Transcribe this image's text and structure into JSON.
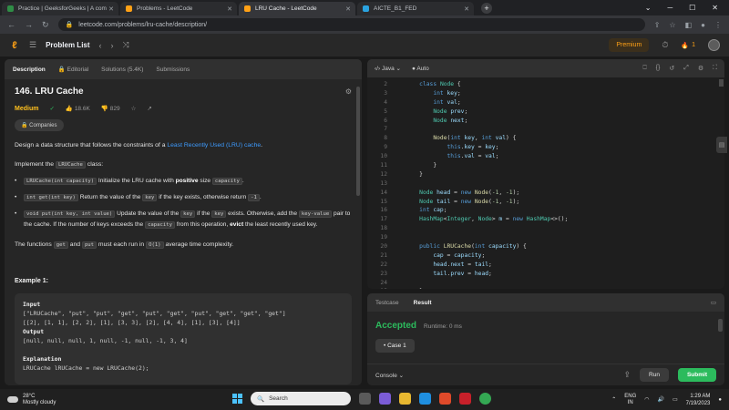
{
  "browser": {
    "tabs": [
      {
        "label": "Practice | GeeksforGeeks | A com",
        "color": "#2f8d46"
      },
      {
        "label": "Problems - LeetCode",
        "color": "#ffa116"
      },
      {
        "label": "LRU Cache - LeetCode",
        "color": "#ffa116"
      },
      {
        "label": "AICTE_B1_FED",
        "color": "#2aa3e0"
      }
    ],
    "url": "leetcode.com/problems/lru-cache/description/"
  },
  "nav": {
    "problem_list": "Problem List",
    "premium": "Premium",
    "streak": "1"
  },
  "left": {
    "tabs": [
      "Description",
      "Editorial",
      "Solutions (5.4K)",
      "Submissions"
    ],
    "title": "146. LRU Cache",
    "difficulty": "Medium",
    "likes": "18.6K",
    "dislikes": "829",
    "companies": "Companies",
    "desc1_pre": "Design a data structure that follows the constraints of a ",
    "desc1_link": "Least Recently Used (LRU) cache",
    "desc1_post": ".",
    "impl_pre": "Implement the ",
    "impl_code": "LRUCache",
    "impl_post": " class:",
    "b1_code": "LRUCache(int capacity)",
    "b1_text1": " Initialize the LRU cache with ",
    "b1_bold": "positive",
    "b1_text2": " size ",
    "b1_code2": "capacity",
    "b1_end": ".",
    "b2_code": "int get(int key)",
    "b2_text1": " Return the value of the ",
    "b2_code2": "key",
    "b2_text2": " if the key exists, otherwise return ",
    "b2_code3": "-1",
    "b2_end": ".",
    "b3_code": "void put(int key, int value)",
    "b3_text1": " Update the value of the ",
    "b3_code2": "key",
    "b3_text2": " if the ",
    "b3_code3": "key",
    "b3_text3": " exists. Otherwise, add the ",
    "b3_code4": "key-value",
    "b3_text4": " pair to the cache. If the number of keys exceeds the ",
    "b3_code5": "capacity",
    "b3_text5": " from this operation, ",
    "b3_bold": "evict",
    "b3_text6": " the least recently used key.",
    "fn_pre": "The functions ",
    "fn_code1": "get",
    "fn_mid": " and ",
    "fn_code2": "put",
    "fn_text": " must each run in ",
    "fn_code3": "O(1)",
    "fn_end": " average time complexity.",
    "example_title": "Example 1:",
    "ex_input_label": "Input",
    "ex_input1": "[\"LRUCache\", \"put\", \"put\", \"get\", \"put\", \"get\", \"put\", \"get\", \"get\", \"get\"]",
    "ex_input2": "[[2], [1, 1], [2, 2], [1], [3, 3], [2], [4, 4], [1], [3], [4]]",
    "ex_output_label": "Output",
    "ex_output": "[null, null, null, 1, null, -1, null, -1, 3, 4]",
    "ex_expl_label": "Explanation",
    "ex_expl1": "LRUCache lRUCache = new LRUCache(2);"
  },
  "editor": {
    "language": "Java",
    "mode": "Auto",
    "lines": [
      {
        "n": "2",
        "html": "    <span class='kw'>class</span> <span class='ty'>Node</span> {"
      },
      {
        "n": "3",
        "html": "        <span class='kw'>int</span> <span class='var'>key</span>;"
      },
      {
        "n": "4",
        "html": "        <span class='kw'>int</span> <span class='var'>val</span>;"
      },
      {
        "n": "5",
        "html": "        <span class='ty'>Node</span> <span class='var'>prev</span>;"
      },
      {
        "n": "6",
        "html": "        <span class='ty'>Node</span> <span class='var'>next</span>;"
      },
      {
        "n": "7",
        "html": ""
      },
      {
        "n": "8",
        "html": "        <span class='fn'>Node</span>(<span class='kw'>int</span> <span class='var'>key</span>, <span class='kw'>int</span> <span class='var'>val</span>) {"
      },
      {
        "n": "9",
        "html": "            <span class='kw'>this</span>.<span class='var'>key</span> = <span class='var'>key</span>;"
      },
      {
        "n": "10",
        "html": "            <span class='kw'>this</span>.<span class='var'>val</span> = <span class='var'>val</span>;"
      },
      {
        "n": "11",
        "html": "        }"
      },
      {
        "n": "12",
        "html": "    }"
      },
      {
        "n": "13",
        "html": ""
      },
      {
        "n": "14",
        "html": "    <span class='ty'>Node</span> <span class='var'>head</span> = <span class='kw'>new</span> <span class='fn'>Node</span>(<span class='num'>-1</span>, <span class='num'>-1</span>);"
      },
      {
        "n": "15",
        "html": "    <span class='ty'>Node</span> <span class='var'>tail</span> = <span class='kw'>new</span> <span class='fn'>Node</span>(<span class='num'>-1</span>, <span class='num'>-1</span>);"
      },
      {
        "n": "16",
        "html": "    <span class='kw'>int</span> <span class='var'>cap</span>;"
      },
      {
        "n": "17",
        "html": "    <span class='ty'>HashMap</span>&lt;<span class='ty'>Integer</span>, <span class='ty'>Node</span>&gt; <span class='var'>m</span> = <span class='kw'>new</span> <span class='ty'>HashMap</span>&lt;&gt;();"
      },
      {
        "n": "18",
        "html": ""
      },
      {
        "n": "19",
        "html": ""
      },
      {
        "n": "20",
        "html": "    <span class='kw'>public</span> <span class='fn'>LRUCache</span>(<span class='kw'>int</span> <span class='var'>capacity</span>) {"
      },
      {
        "n": "21",
        "html": "        <span class='var'>cap</span> = <span class='var'>capacity</span>;"
      },
      {
        "n": "22",
        "html": "        <span class='var'>head</span>.<span class='var'>next</span> = <span class='var'>tail</span>;"
      },
      {
        "n": "23",
        "html": "        <span class='var'>tail</span>.<span class='var'>prev</span> = <span class='var'>head</span>;"
      },
      {
        "n": "24",
        "html": ""
      },
      {
        "n": "25",
        "html": "    }"
      }
    ]
  },
  "console": {
    "tabs": [
      "Testcase",
      "Result"
    ],
    "status": "Accepted",
    "runtime": "Runtime: 0 ms",
    "case": "Case 1",
    "console_label": "Console",
    "run": "Run",
    "submit": "Submit"
  },
  "taskbar": {
    "temp": "28°C",
    "weather": "Mostly cloudy",
    "search": "Search",
    "lang1": "ENG",
    "lang2": "IN",
    "time": "1:29 AM",
    "date": "7/19/2023"
  },
  "colors": {
    "accent": "#ffa116",
    "accepted": "#2cbb5d",
    "link": "#3d9bff",
    "medium": "#ffc01e"
  }
}
